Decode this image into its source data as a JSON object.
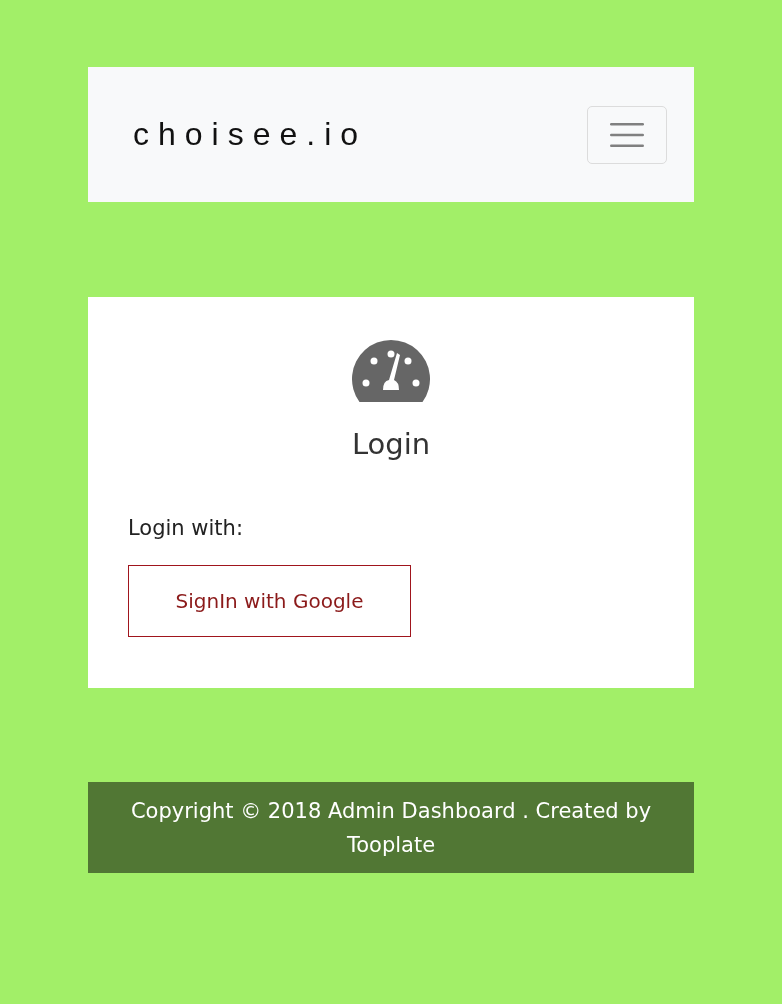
{
  "navbar": {
    "brand": "choisee.io"
  },
  "login": {
    "title": "Login",
    "prompt": "Login with:",
    "button": "SignIn with Google"
  },
  "footer": {
    "text": "Copyright © 2018 Admin Dashboard . Created by Tooplate"
  }
}
